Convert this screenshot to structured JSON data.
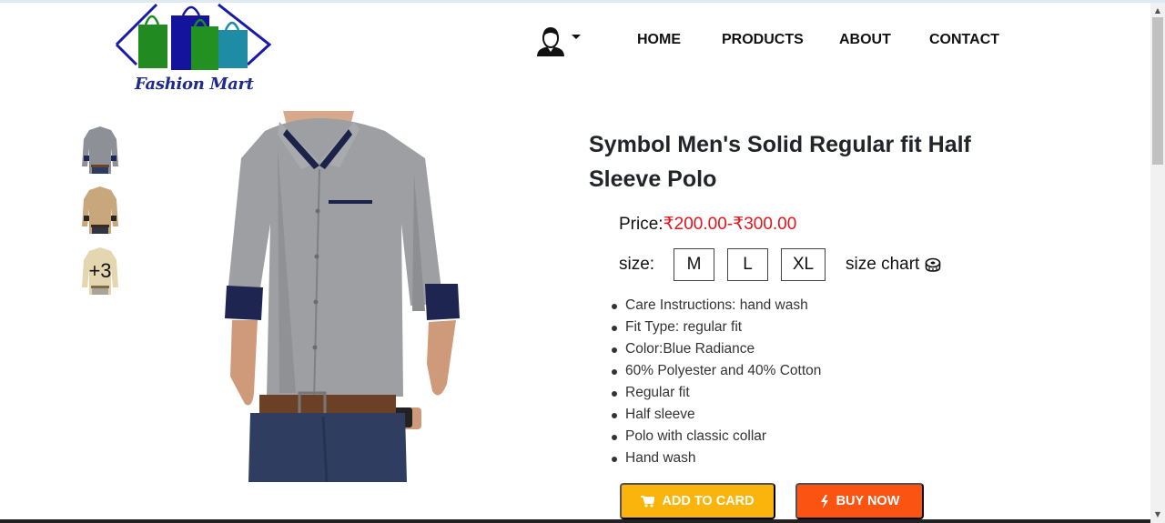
{
  "brand": {
    "name": "Fashion Mart"
  },
  "nav": {
    "items": [
      "HOME",
      "PRODUCTS",
      "ABOUT",
      "CONTACT"
    ]
  },
  "gallery": {
    "more_count": "+3"
  },
  "product": {
    "title": "Symbol Men's Solid Regular fit Half Sleeve Polo",
    "price_label": "Price:",
    "price_value": "₹200.00-₹300.00",
    "size_label": "size:",
    "sizes": [
      "M",
      "L",
      "XL"
    ],
    "size_chart_label": "size chart",
    "features": [
      "Care Instructions: hand wash",
      "Fit Type: regular fit",
      "Color:Blue Radiance",
      "60% Polyester and 40% Cotton",
      "Regular fit",
      "Half sleeve",
      "Polo with classic collar",
      "Hand wash"
    ],
    "add_to_cart_label": "ADD TO CARD",
    "buy_now_label": "BUY NOW"
  },
  "colors": {
    "price": "#e3141b",
    "add_to_cart": "#fbb40c",
    "buy_now": "#fb5412",
    "logo_text": "#1e2a8c"
  },
  "icons": {
    "user": "user-avatar-icon",
    "caret": "caret-down-icon",
    "tape": "measuring-tape-icon",
    "cart": "cart-icon",
    "bolt": "bolt-icon"
  }
}
